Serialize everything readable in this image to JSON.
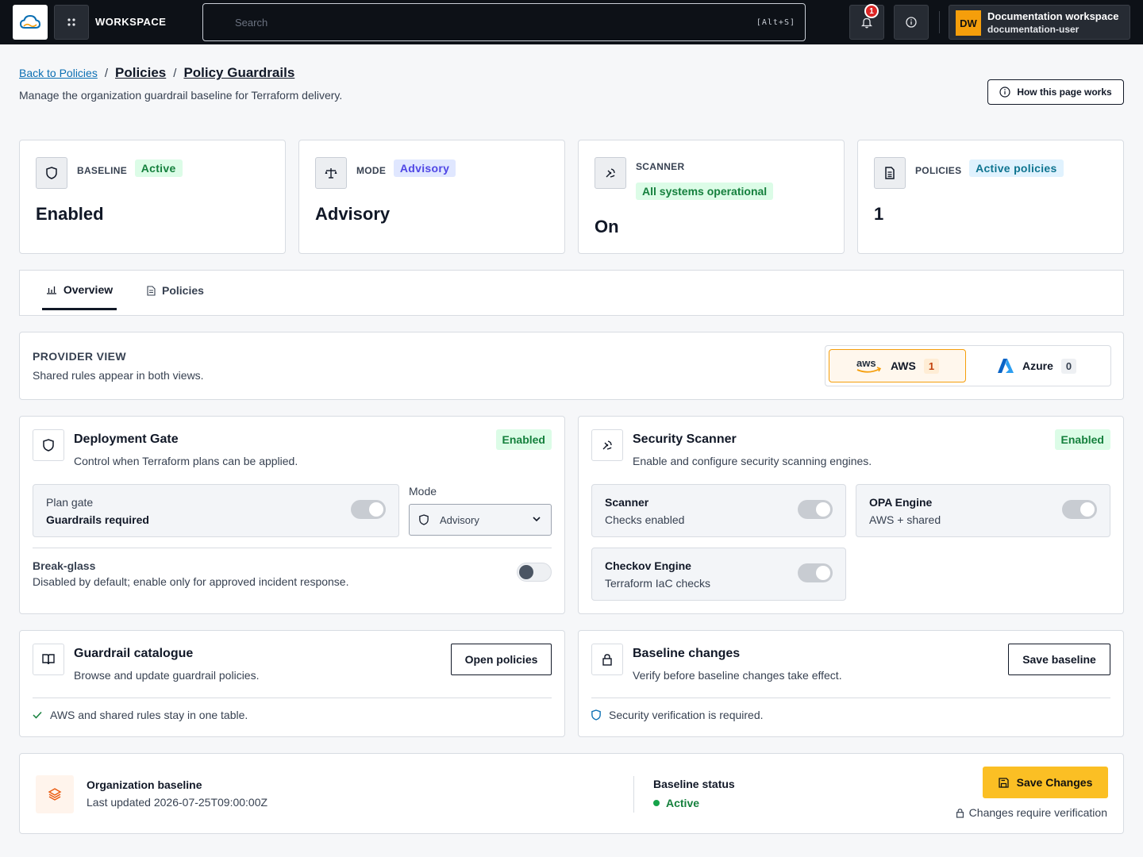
{
  "topbar": {
    "workspace_label": "WORKSPACE",
    "search_placeholder": "Search",
    "search_shortcut": "[Alt+S]",
    "notification_count": "1",
    "user": {
      "initials": "DW",
      "name": "Documentation workspace",
      "id": "documentation-user"
    },
    "icons": [
      "cloud-logo-icon",
      "apps-grid-icon",
      "bell-icon",
      "info-icon"
    ]
  },
  "breadcrumbs": {
    "back": "Back to Policies",
    "items": [
      "Policies",
      "Policy Guardrails"
    ]
  },
  "page": {
    "subtitle": "Manage the organization guardrail baseline for Terraform delivery.",
    "how_button": "How this page works"
  },
  "stats": [
    {
      "label": "BASELINE",
      "badge": "Active",
      "value": "Enabled",
      "icon": "shield-icon"
    },
    {
      "label": "MODE",
      "badge": "Advisory",
      "value": "Advisory",
      "icon": "scale-icon"
    },
    {
      "label": "SCANNER",
      "badge": "All systems operational",
      "value": "On",
      "icon": "radar-icon"
    },
    {
      "label": "POLICIES",
      "badge": "Active policies",
      "value": "1",
      "icon": "document-icon"
    }
  ],
  "tabs": [
    {
      "label": "Overview",
      "icon": "bar-chart-icon",
      "active": true
    },
    {
      "label": "Policies",
      "icon": "document-icon",
      "active": false
    }
  ],
  "provider_view": {
    "title": "PROVIDER VIEW",
    "subtitle": "Shared rules appear in both views.",
    "options": [
      {
        "label": "AWS",
        "count": "1",
        "logo": "aws",
        "selected": true
      },
      {
        "label": "Azure",
        "count": "0",
        "logo": "azure",
        "selected": false
      }
    ]
  },
  "deployment_gate": {
    "title": "Deployment Gate",
    "subtitle": "Control when Terraform plans can be applied.",
    "status": "Enabled",
    "plan_gate": {
      "title": "Plan gate",
      "value": "Guardrails required",
      "enabled": true
    },
    "mode": {
      "label": "Mode",
      "value": "Advisory"
    },
    "break_glass": {
      "title": "Break-glass",
      "subtitle": "Disabled by default; enable only for approved incident response.",
      "enabled": false
    }
  },
  "security_scanner": {
    "title": "Security Scanner",
    "subtitle": "Enable and configure security scanning engines.",
    "status": "Enabled",
    "engines": [
      {
        "title": "Scanner",
        "value": "Checks enabled",
        "enabled": true
      },
      {
        "title": "OPA Engine",
        "value": "AWS + shared",
        "enabled": true
      },
      {
        "title": "Checkov Engine",
        "value": "Terraform IaC checks",
        "enabled": true
      }
    ]
  },
  "catalogue": {
    "title": "Guardrail catalogue",
    "subtitle": "Browse and update guardrail policies.",
    "button": "Open policies",
    "note": "AWS and shared rules stay in one table."
  },
  "baseline_changes": {
    "title": "Baseline changes",
    "subtitle": "Verify before baseline changes take effect.",
    "button": "Save baseline",
    "note": "Security verification is required."
  },
  "footer": {
    "title": "Organization baseline",
    "updated": "Last updated 2026-07-25T09:00:00Z",
    "status_label": "Baseline status",
    "status_value": "Active",
    "save_button": "Save Changes",
    "lock_note": "Changes require verification"
  },
  "colors": {
    "accent": "#fbbf24",
    "success": "#15803d",
    "link": "#0b6fb3",
    "topbar": "#0d1117"
  }
}
